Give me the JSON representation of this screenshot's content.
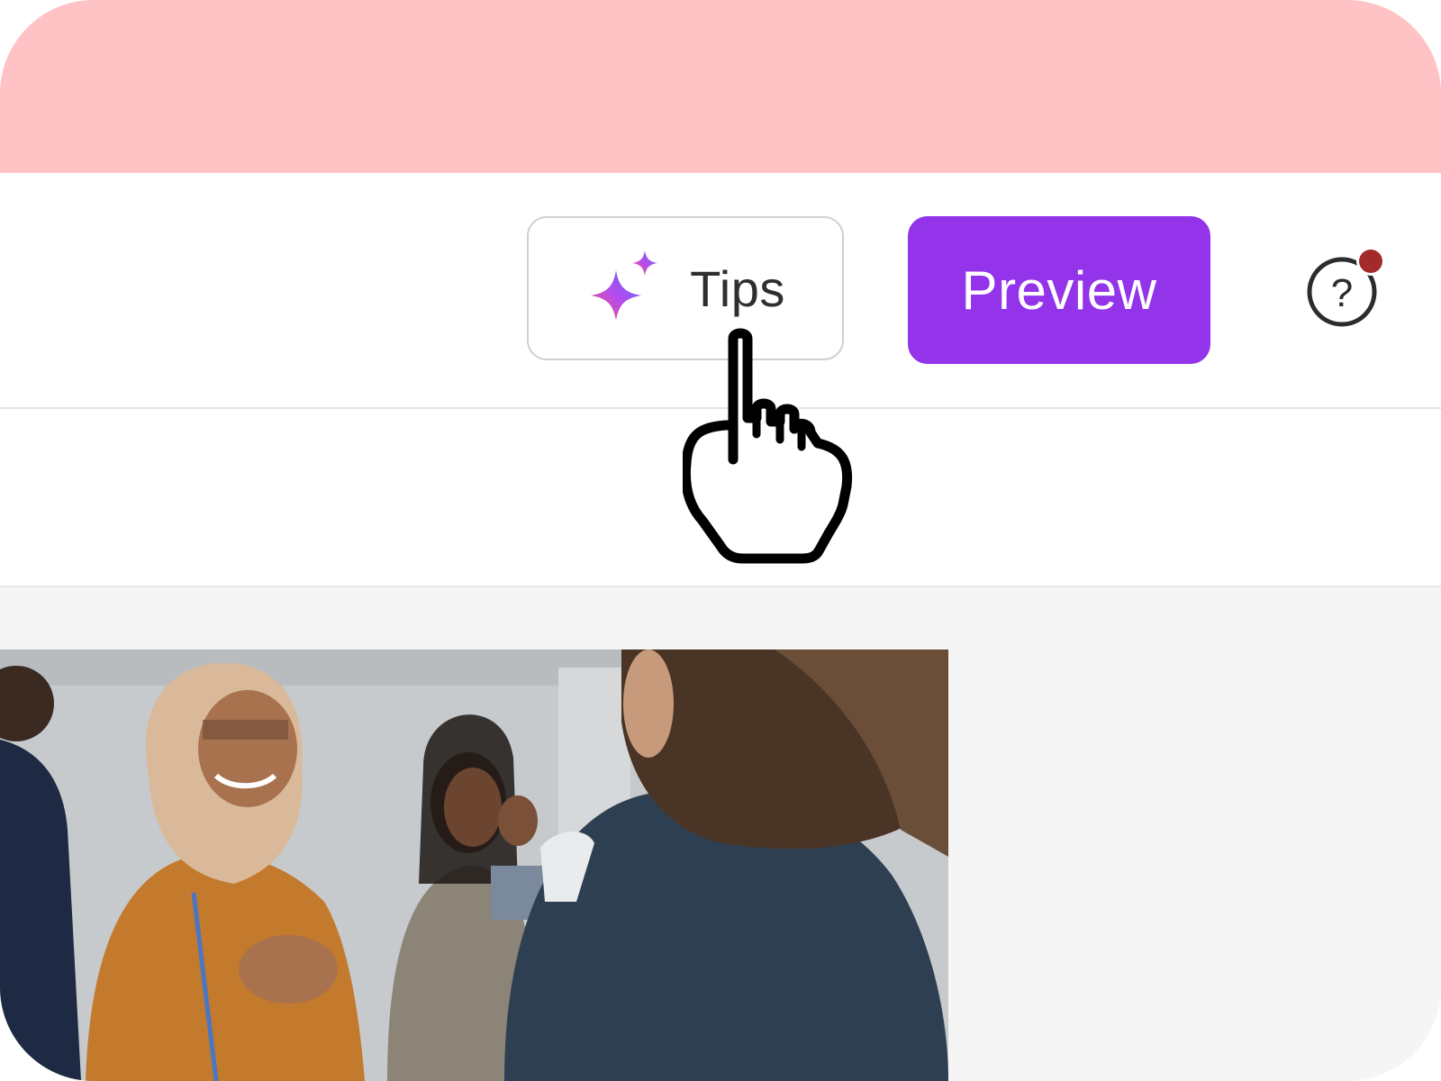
{
  "toolbar": {
    "tips": {
      "label": "Tips",
      "icon": "sparkle-icon"
    },
    "preview": {
      "label": "Preview"
    },
    "help": {
      "icon": "help-circle-icon",
      "has_notification": true
    }
  },
  "cursor": {
    "icon": "pointing-hand-cursor-icon"
  },
  "colors": {
    "top_band": "#ffc2c5",
    "accent": "#9333ea",
    "notification_dot": "#a32a2a",
    "canvas_bg": "#f4f5f4"
  }
}
